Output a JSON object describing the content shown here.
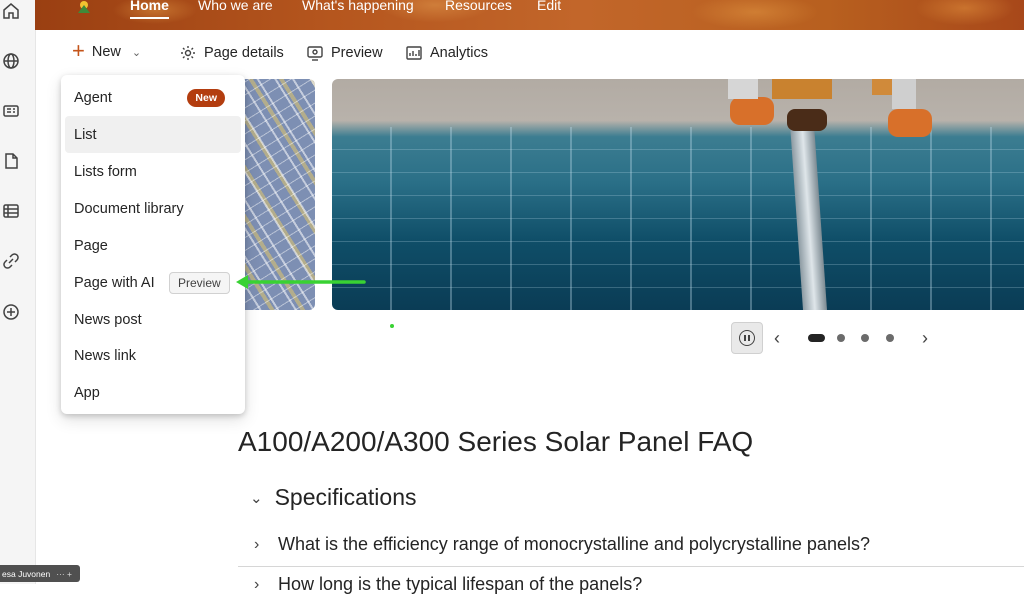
{
  "top_nav": {
    "items": [
      {
        "label": "Home",
        "active": true
      },
      {
        "label": "Who we are"
      },
      {
        "label": "What's happening"
      },
      {
        "label": "Resources"
      },
      {
        "label": "Edit"
      }
    ]
  },
  "command_bar": {
    "new_label": "New",
    "page_details_label": "Page details",
    "preview_label": "Preview",
    "analytics_label": "Analytics"
  },
  "new_menu": {
    "items": [
      {
        "label": "Agent",
        "badge": "New"
      },
      {
        "label": "List",
        "hovered": true
      },
      {
        "label": "Lists form"
      },
      {
        "label": "Document library"
      },
      {
        "label": "Page"
      },
      {
        "label": "Page with AI",
        "badge": "Preview"
      },
      {
        "label": "News post"
      },
      {
        "label": "News link"
      },
      {
        "label": "App"
      }
    ]
  },
  "carousel": {
    "slide_count": 4,
    "active_slide": 1
  },
  "content": {
    "page_title": "A100/A200/A300 Series Solar Panel FAQ",
    "section_title": "Specifications",
    "questions": [
      "What is the efficiency range of monocrystalline and polycrystalline panels?",
      "How long is the typical lifespan of the panels?"
    ]
  },
  "taskbar": {
    "user_label": "esa Juvonen",
    "extra": "··· +"
  },
  "colors": {
    "accent_badge": "#b33d0f",
    "annotation_arrow": "#39d233",
    "banner": "#b5561e"
  }
}
